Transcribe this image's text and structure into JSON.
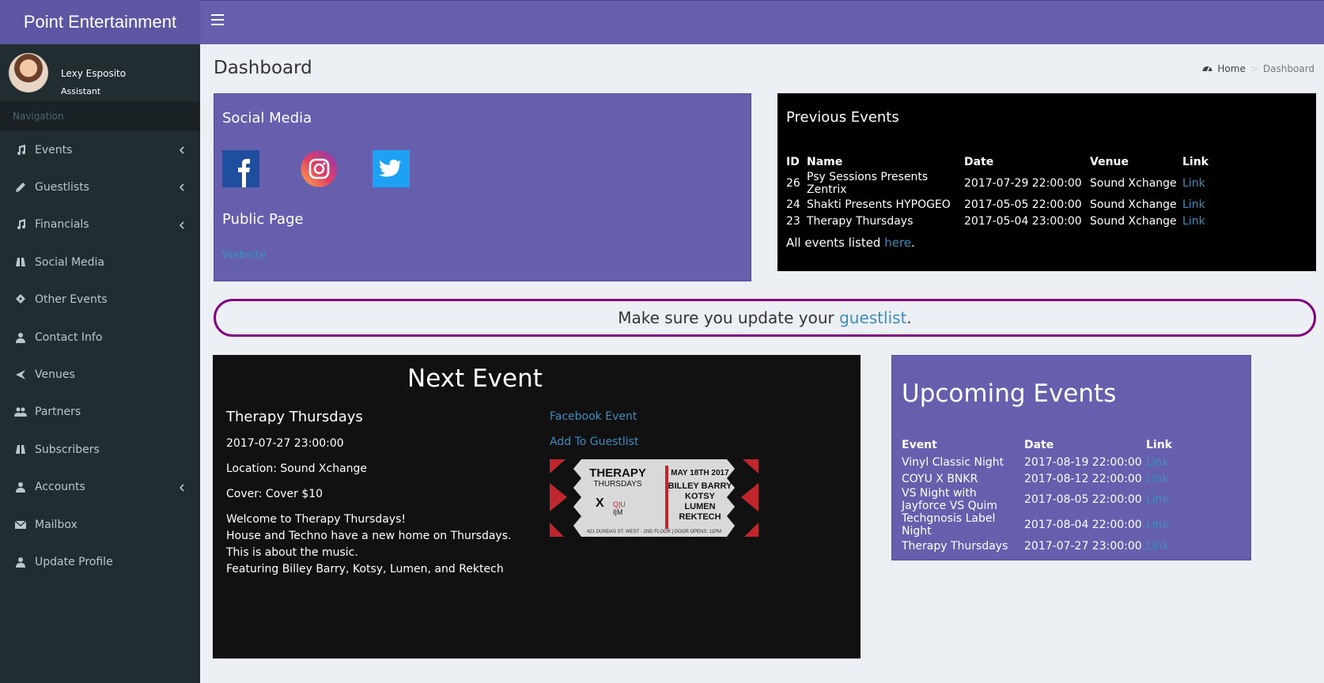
{
  "header": {
    "app_title": "Point Entertainment"
  },
  "user": {
    "name": "Lexy Esposito",
    "role": "Assistant"
  },
  "sidebar": {
    "header": "Navigation",
    "items": [
      {
        "label": "Events",
        "icon": "music-icon",
        "has_submenu": true
      },
      {
        "label": "Guestlists",
        "icon": "pencil-icon",
        "has_submenu": true
      },
      {
        "label": "Financials",
        "icon": "music-icon",
        "has_submenu": true
      },
      {
        "label": "Social Media",
        "icon": "binoculars-icon",
        "has_submenu": false
      },
      {
        "label": "Other Events",
        "icon": "ticket-icon",
        "has_submenu": false
      },
      {
        "label": "Contact Info",
        "icon": "user-icon",
        "has_submenu": false
      },
      {
        "label": "Venues",
        "icon": "plane-icon",
        "has_submenu": false
      },
      {
        "label": "Partners",
        "icon": "users-icon",
        "has_submenu": false
      },
      {
        "label": "Subscribers",
        "icon": "binoculars-icon",
        "has_submenu": false
      },
      {
        "label": "Accounts",
        "icon": "user-icon",
        "has_submenu": true
      },
      {
        "label": "Mailbox",
        "icon": "envelope-icon",
        "has_submenu": false
      },
      {
        "label": "Update Profile",
        "icon": "user-icon",
        "has_submenu": false
      }
    ]
  },
  "page": {
    "title": "Dashboard",
    "breadcrumb": {
      "home": "Home",
      "current": "Dashboard"
    }
  },
  "social_box": {
    "title": "Social Media",
    "public_title": "Public Page",
    "website_label": "Website",
    "icons": [
      "facebook-icon",
      "instagram-icon",
      "twitter-icon"
    ]
  },
  "previous_events": {
    "title": "Previous Events",
    "headers": [
      "ID",
      "Name",
      "Date",
      "Venue",
      "Link"
    ],
    "rows": [
      {
        "id": "26",
        "name": "Psy Sessions Presents Zentrix",
        "date": "2017-07-29 22:00:00",
        "venue": "Sound Xchange",
        "link": "Link"
      },
      {
        "id": "24",
        "name": "Shakti Presents HYPOGEO",
        "date": "2017-05-05 22:00:00",
        "venue": "Sound Xchange",
        "link": "Link"
      },
      {
        "id": "23",
        "name": "Therapy Thursdays",
        "date": "2017-05-04 23:00:00",
        "venue": "Sound Xchange",
        "link": "Link"
      }
    ],
    "all_prefix": "All events listed ",
    "all_link": "here",
    "all_suffix": "."
  },
  "notice": {
    "prefix": "Make sure you update your ",
    "link": "guestlist",
    "suffix": "."
  },
  "next_event": {
    "title": "Next Event",
    "name": "Therapy Thursdays",
    "date": "2017-07-27 23:00:00",
    "location": "Location: Sound Xchange",
    "cover": "Cover: Cover $10",
    "description": [
      "Welcome to Therapy Thursdays!",
      "House and Techno have a new home on Thursdays.",
      "This is about the music.",
      "Featuring Billey Barry, Kotsy, Lumen, and Rektech"
    ],
    "facebook_link": "Facebook Event",
    "guestlist_link": "Add To Guestlist",
    "flyer": {
      "title_line1": "THERAPY",
      "title_line2": "THURSDAYS",
      "date_text": "MAY 18TH 2017",
      "lineup": [
        "BILLEY BARRY",
        "KOTSY",
        "LUMEN",
        "REKTECH"
      ],
      "footer": "421 DUNDAS ST. WEST · 2ND FLOOR | DOOR OPENS: 11PM"
    }
  },
  "upcoming_events": {
    "title": "Upcoming Events",
    "headers": [
      "Event",
      "Date",
      "Link"
    ],
    "rows": [
      {
        "event": "Vinyl Classic Night",
        "date": "2017-08-19 22:00:00",
        "link": "Link"
      },
      {
        "event": "COYU X BNKR",
        "date": "2017-08-12 22:00:00",
        "link": "Link"
      },
      {
        "event": "VS Night with Jayforce VS Quim",
        "date": "2017-08-05 22:00:00",
        "link": "Link"
      },
      {
        "event": "Techgnosis Label Night",
        "date": "2017-08-04 22:00:00",
        "link": "Link"
      },
      {
        "event": "Therapy Thursdays",
        "date": "2017-07-27 23:00:00",
        "link": "Link"
      }
    ]
  },
  "colors": {
    "header": "#655fad",
    "logo_bg": "#5d57a3",
    "sidebar_bg": "#222d32",
    "link": "#3c8dbc",
    "notice_border": "#800080"
  }
}
